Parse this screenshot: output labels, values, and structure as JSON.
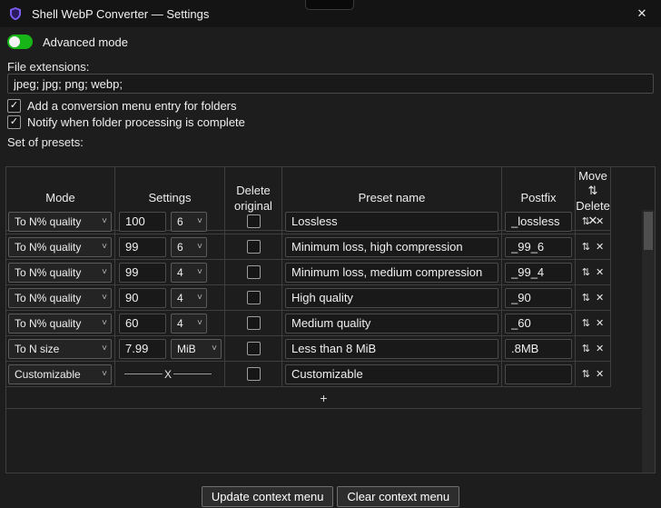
{
  "window": {
    "title": "Shell WebP Converter — Settings"
  },
  "glyphs": {
    "close": "✕",
    "chevron": "˅",
    "check": "✓",
    "move": "⇅",
    "delete": "✕",
    "plus": "+"
  },
  "toggle": {
    "label": "Advanced mode",
    "on": true
  },
  "file_extensions": {
    "label": "File extensions:",
    "value": "jpeg; jpg; png; webp;"
  },
  "checkboxes": [
    {
      "label": "Add a conversion menu entry for folders",
      "checked": true
    },
    {
      "label": "Notify when folder processing is complete",
      "checked": true
    }
  ],
  "presets": {
    "label": "Set of presets:",
    "headers": {
      "mode": "Mode",
      "settings": "Settings",
      "delete_original": "Delete original",
      "preset_name": "Preset name",
      "postfix": "Postfix",
      "move": "Move ⇅",
      "delete": "Delete ✕"
    },
    "rows": [
      {
        "mode": "To N% quality",
        "value": "100",
        "unit": "6",
        "preset": "Lossless",
        "postfix": "_lossless"
      },
      {
        "mode": "To N% quality",
        "value": "99",
        "unit": "6",
        "preset": "Minimum loss, high compression",
        "postfix": "_99_6"
      },
      {
        "mode": "To N% quality",
        "value": "99",
        "unit": "4",
        "preset": "Minimum loss, medium compression",
        "postfix": "_99_4"
      },
      {
        "mode": "To N% quality",
        "value": "90",
        "unit": "4",
        "preset": "High quality",
        "postfix": "_90"
      },
      {
        "mode": "To N% quality",
        "value": "60",
        "unit": "4",
        "preset": "Medium quality",
        "postfix": "_60"
      },
      {
        "mode": "To N size",
        "value": "7.99",
        "unit": "MiB",
        "preset": "Less than 8 MiB",
        "postfix": ".8MB"
      },
      {
        "mode": "Customizable",
        "settings_custom": "X",
        "preset": "Customizable",
        "postfix": ""
      }
    ]
  },
  "footer": {
    "update_button": "Update context menu",
    "clear_button": "Clear context menu"
  },
  "accent": {
    "toggle_green": "#17b517",
    "icon_purple": "#7b5cf0"
  }
}
